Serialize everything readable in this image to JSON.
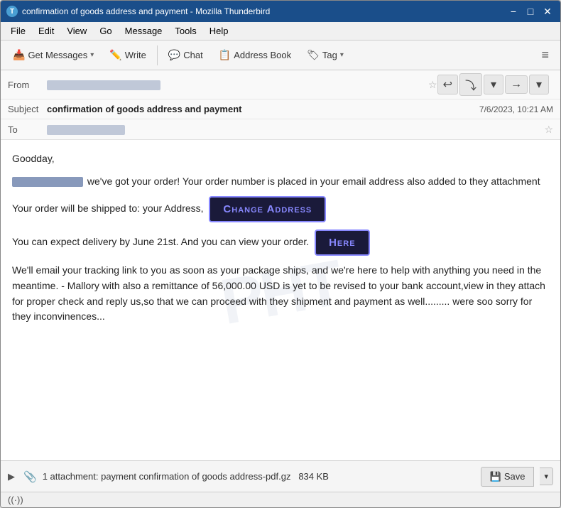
{
  "window": {
    "title": "confirmation of goods address and payment - Mozilla Thunderbird",
    "icon": "T"
  },
  "titlebar": {
    "minimize": "−",
    "maximize": "□",
    "close": "✕"
  },
  "menubar": {
    "items": [
      "File",
      "Edit",
      "View",
      "Go",
      "Message",
      "Tools",
      "Help"
    ]
  },
  "toolbar": {
    "get_messages_label": "Get Messages",
    "write_label": "Write",
    "chat_label": "Chat",
    "address_book_label": "Address Book",
    "tag_label": "Tag",
    "tag_arrow": "▾",
    "hamburger": "≡"
  },
  "email_header": {
    "from_label": "From",
    "to_label": "To",
    "subject_label": "Subject",
    "subject_value": "confirmation of goods address and payment",
    "date_value": "7/6/2023, 10:21 AM",
    "action_reply": "↩",
    "action_reply_all": "⤵",
    "action_dropdown": "▾",
    "action_forward": "→",
    "action_forward_dropdown": "▾"
  },
  "email_body": {
    "greeting": "Goodday,",
    "paragraph1_after": " we've got your order! Your order number is placed in your email address also added to they attachment",
    "paragraph2_before": "Your order will be shipped to: your Address,",
    "change_address_btn": "Change Address",
    "paragraph3_before": "You can expect delivery by June 21st. And you can view your order.",
    "here_btn": "Here",
    "paragraph4": "We'll email your tracking link to you as soon as your package ships, and we're here to help with anything you need in the meantime. - Mallory with also a remittance of 56,000.00 USD is yet to be revised to your bank account,view in they attach for proper check and reply us,so that we  can proceed with they shipment and payment as well......... were soo sorry for they inconvinences..."
  },
  "attachment": {
    "count_label": "1 attachment:",
    "filename": "payment confirmation of goods address-pdf.gz",
    "size": "834 KB",
    "save_label": "Save",
    "clip_icon": "📎",
    "expand_icon": "▶"
  },
  "statusbar": {
    "wifi_icon": "((·))"
  }
}
